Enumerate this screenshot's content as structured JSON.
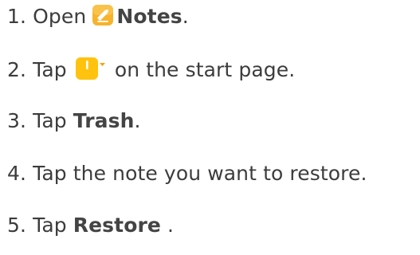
{
  "steps": [
    {
      "number": "1.",
      "before": "Open",
      "icon": "notes-app-icon",
      "bold": "Notes",
      "after": "."
    },
    {
      "number": "2.",
      "before": "Tap",
      "icon": "new-note-dropdown-icon",
      "after": "on the start page."
    },
    {
      "number": "3.",
      "before": "Tap",
      "bold": "Trash",
      "after": "."
    },
    {
      "number": "4.",
      "before": "Tap the note you want to restore."
    },
    {
      "number": "5.",
      "before": "Tap",
      "bold": "Restore",
      "after": " ."
    }
  ],
  "colors": {
    "text": "#3c3c3c",
    "icon_orange": "#f6a623",
    "icon_yellow": "#ffc20e"
  }
}
